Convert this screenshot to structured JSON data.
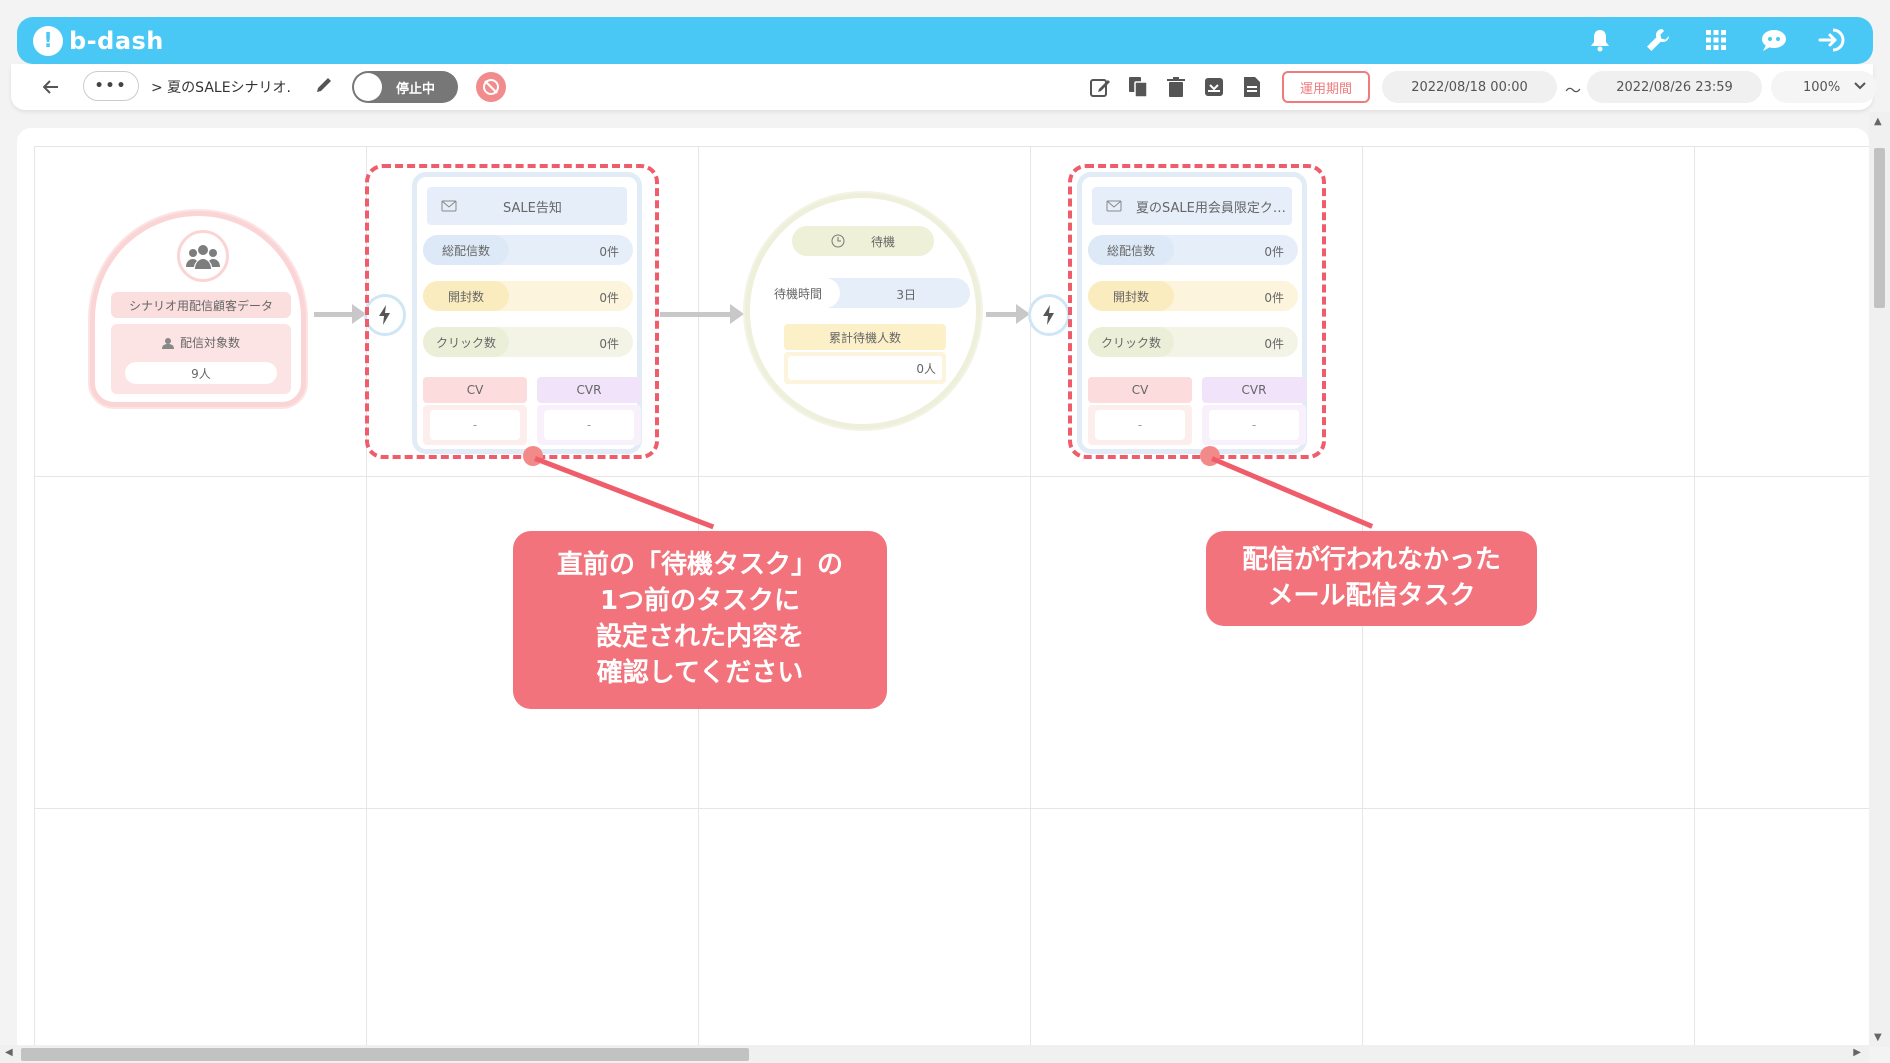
{
  "app": {
    "logo_text": "b-dash"
  },
  "header": {
    "icons": [
      "bell-icon",
      "wrench-icon",
      "apps-grid-icon",
      "chat-bot-icon",
      "logout-icon"
    ]
  },
  "toolbar": {
    "breadcrumb_more": "•••",
    "breadcrumb_text": "> 夏のSALEシナリオ.",
    "status_toggle_label": "停止中",
    "period_label": "運用期間",
    "start_date": "2022/08/18 00:00",
    "date_separator": "～",
    "end_date": "2022/08/26 23:59",
    "zoom": "100%"
  },
  "nodes": {
    "start": {
      "label": "シナリオ用配信顧客データ",
      "count_title": "配信対象数",
      "count_value": "9人"
    },
    "mail1": {
      "title": "SALE告知",
      "total_label": "総配信数",
      "total_value": "0件",
      "open_label": "開封数",
      "open_value": "0件",
      "click_label": "クリック数",
      "click_value": "0件",
      "cv_label": "CV",
      "cv_value": "-",
      "cvr_label": "CVR",
      "cvr_value": "-"
    },
    "wait": {
      "title": "待機",
      "time_label": "待機時間",
      "time_value": "3日",
      "cum_label": "累計待機人数",
      "cum_value": "0人"
    },
    "mail2": {
      "title": "夏のSALE用会員限定ク…",
      "total_label": "総配信数",
      "total_value": "0件",
      "open_label": "開封数",
      "open_value": "0件",
      "click_label": "クリック数",
      "click_value": "0件",
      "cv_label": "CV",
      "cv_value": "-",
      "cvr_label": "CVR",
      "cvr_value": "-"
    }
  },
  "callouts": {
    "left": [
      "直前の「待機タスク」の",
      "1つ前のタスクに",
      "設定された内容を",
      "確認してください"
    ],
    "right": [
      "配信が行われなかった",
      "メール配信タスク"
    ]
  },
  "colors": {
    "header_bg": "#4ac8f5",
    "highlight": "#ef5d6a",
    "callout_bg": "#f2737b"
  }
}
